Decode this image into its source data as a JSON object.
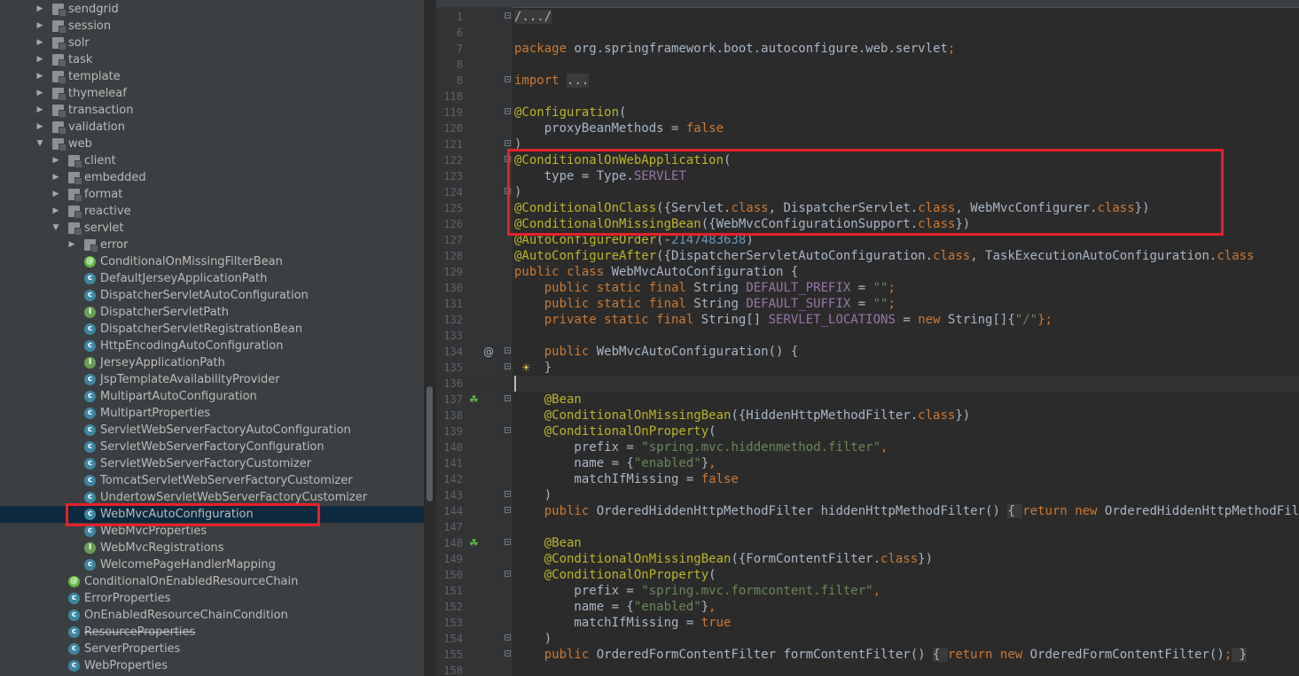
{
  "project_tree": {
    "selected_item": "WebMvcAutoConfiguration",
    "rows": [
      {
        "label": "sendgrid",
        "kind": "package",
        "depth": 0,
        "expanded": false
      },
      {
        "label": "session",
        "kind": "package",
        "depth": 0,
        "expanded": false
      },
      {
        "label": "solr",
        "kind": "package",
        "depth": 0,
        "expanded": false
      },
      {
        "label": "task",
        "kind": "package",
        "depth": 0,
        "expanded": false
      },
      {
        "label": "template",
        "kind": "package",
        "depth": 0,
        "expanded": false
      },
      {
        "label": "thymeleaf",
        "kind": "package",
        "depth": 0,
        "expanded": false
      },
      {
        "label": "transaction",
        "kind": "package",
        "depth": 0,
        "expanded": false
      },
      {
        "label": "validation",
        "kind": "package",
        "depth": 0,
        "expanded": false
      },
      {
        "label": "web",
        "kind": "package",
        "depth": 0,
        "expanded": true
      },
      {
        "label": "client",
        "kind": "package",
        "depth": 1,
        "expanded": false
      },
      {
        "label": "embedded",
        "kind": "package",
        "depth": 1,
        "expanded": false
      },
      {
        "label": "format",
        "kind": "package",
        "depth": 1,
        "expanded": false
      },
      {
        "label": "reactive",
        "kind": "package",
        "depth": 1,
        "expanded": false
      },
      {
        "label": "servlet",
        "kind": "package",
        "depth": 1,
        "expanded": true
      },
      {
        "label": "error",
        "kind": "package",
        "depth": 2,
        "expanded": false
      },
      {
        "label": "ConditionalOnMissingFilterBean",
        "kind": "annotation",
        "depth": 3
      },
      {
        "label": "DefaultJerseyApplicationPath",
        "kind": "class",
        "depth": 3
      },
      {
        "label": "DispatcherServletAutoConfiguration",
        "kind": "class",
        "depth": 3
      },
      {
        "label": "DispatcherServletPath",
        "kind": "interface",
        "depth": 3
      },
      {
        "label": "DispatcherServletRegistrationBean",
        "kind": "class",
        "depth": 3
      },
      {
        "label": "HttpEncodingAutoConfiguration",
        "kind": "class",
        "depth": 3
      },
      {
        "label": "JerseyApplicationPath",
        "kind": "interface",
        "depth": 3
      },
      {
        "label": "JspTemplateAvailabilityProvider",
        "kind": "class",
        "depth": 3
      },
      {
        "label": "MultipartAutoConfiguration",
        "kind": "class",
        "depth": 3
      },
      {
        "label": "MultipartProperties",
        "kind": "class",
        "depth": 3
      },
      {
        "label": "ServletWebServerFactoryAutoConfiguration",
        "kind": "class",
        "depth": 3
      },
      {
        "label": "ServletWebServerFactoryConfiguration",
        "kind": "class",
        "depth": 3
      },
      {
        "label": "ServletWebServerFactoryCustomizer",
        "kind": "class",
        "depth": 3
      },
      {
        "label": "TomcatServletWebServerFactoryCustomizer",
        "kind": "class",
        "depth": 3
      },
      {
        "label": "UndertowServletWebServerFactoryCustomizer",
        "kind": "class",
        "depth": 3
      },
      {
        "label": "WebMvcAutoConfiguration",
        "kind": "class",
        "depth": 3,
        "selected": true
      },
      {
        "label": "WebMvcProperties",
        "kind": "class",
        "depth": 3
      },
      {
        "label": "WebMvcRegistrations",
        "kind": "interface",
        "depth": 3
      },
      {
        "label": "WelcomePageHandlerMapping",
        "kind": "class",
        "depth": 3
      },
      {
        "label": "ConditionalOnEnabledResourceChain",
        "kind": "annotation",
        "depth": 2
      },
      {
        "label": "ErrorProperties",
        "kind": "class",
        "depth": 2
      },
      {
        "label": "OnEnabledResourceChainCondition",
        "kind": "class",
        "depth": 2
      },
      {
        "label": "ResourceProperties",
        "kind": "class",
        "depth": 2,
        "deprecated": true
      },
      {
        "label": "ServerProperties",
        "kind": "class",
        "depth": 2
      },
      {
        "label": "WebProperties",
        "kind": "class",
        "depth": 2
      }
    ]
  },
  "editor": {
    "file": "WebMvcAutoConfiguration",
    "lines": [
      {
        "no": "1",
        "fold": true,
        "spans": [
          {
            "t": "/.../",
            "c": "fb"
          }
        ]
      },
      {
        "no": "6",
        "spans": []
      },
      {
        "no": "7",
        "spans": [
          {
            "t": "package ",
            "c": "k"
          },
          {
            "t": "org.springframework.boot.autoconfigure.web.servlet"
          },
          {
            "t": ";",
            "c": "k"
          }
        ]
      },
      {
        "no": "8",
        "spans": []
      },
      {
        "no": "8",
        "fold": true,
        "spans": [
          {
            "t": "import ",
            "c": "k"
          },
          {
            "t": "...",
            "c": "fb"
          }
        ]
      },
      {
        "no": "118",
        "spans": []
      },
      {
        "no": "119",
        "fold": true,
        "spans": [
          {
            "t": "@Configuration",
            "c": "a"
          },
          {
            "t": "("
          }
        ]
      },
      {
        "no": "120",
        "spans": [
          {
            "t": "    proxyBeanMethods = "
          },
          {
            "t": "false",
            "c": "k"
          }
        ]
      },
      {
        "no": "121",
        "fold": true,
        "spans": [
          {
            "t": ")"
          }
        ]
      },
      {
        "no": "122",
        "fold": true,
        "spans": [
          {
            "t": "@ConditionalOnWebApplication",
            "c": "a"
          },
          {
            "t": "("
          }
        ]
      },
      {
        "no": "123",
        "spans": [
          {
            "t": "    type = Type."
          },
          {
            "t": "SERVLET",
            "c": "fld"
          }
        ]
      },
      {
        "no": "124",
        "fold": true,
        "spans": [
          {
            "t": ")"
          }
        ]
      },
      {
        "no": "125",
        "spans": [
          {
            "t": "@ConditionalOnClass",
            "c": "a"
          },
          {
            "t": "({Servlet."
          },
          {
            "t": "class",
            "c": "k"
          },
          {
            "t": ", DispatcherServlet."
          },
          {
            "t": "class",
            "c": "k"
          },
          {
            "t": ", WebMvcConfigurer."
          },
          {
            "t": "class",
            "c": "k"
          },
          {
            "t": "})"
          }
        ]
      },
      {
        "no": "126",
        "spans": [
          {
            "t": "@ConditionalOnMissingBean",
            "c": "a"
          },
          {
            "t": "({WebMvcConfigurationSupport."
          },
          {
            "t": "class",
            "c": "k"
          },
          {
            "t": "})"
          }
        ]
      },
      {
        "no": "127",
        "spans": [
          {
            "t": "@AutoConfigureOrder",
            "c": "a"
          },
          {
            "t": "(-"
          },
          {
            "t": "2147483638",
            "c": "n"
          },
          {
            "t": ")"
          }
        ]
      },
      {
        "no": "128",
        "spans": [
          {
            "t": "@AutoConfigureAfter",
            "c": "a"
          },
          {
            "t": "({DispatcherServletAutoConfiguration."
          },
          {
            "t": "class",
            "c": "k"
          },
          {
            "t": ", TaskExecutionAutoConfiguration."
          },
          {
            "t": "class",
            "c": "k"
          }
        ]
      },
      {
        "no": "129",
        "spans": [
          {
            "t": "public class ",
            "c": "k"
          },
          {
            "t": "WebMvcAutoConfiguration {"
          }
        ]
      },
      {
        "no": "130",
        "spans": [
          {
            "t": "    "
          },
          {
            "t": "public static final ",
            "c": "k"
          },
          {
            "t": "String "
          },
          {
            "t": "DEFAULT_PREFIX",
            "c": "fld"
          },
          {
            "t": " = "
          },
          {
            "t": "\"\"",
            "c": "s"
          },
          {
            "t": ";",
            "c": "k"
          }
        ]
      },
      {
        "no": "131",
        "spans": [
          {
            "t": "    "
          },
          {
            "t": "public static final ",
            "c": "k"
          },
          {
            "t": "String "
          },
          {
            "t": "DEFAULT_SUFFIX",
            "c": "fld"
          },
          {
            "t": " = "
          },
          {
            "t": "\"\"",
            "c": "s"
          },
          {
            "t": ";",
            "c": "k"
          }
        ]
      },
      {
        "no": "132",
        "spans": [
          {
            "t": "    "
          },
          {
            "t": "private static final ",
            "c": "k"
          },
          {
            "t": "String[] "
          },
          {
            "t": "SERVLET_LOCATIONS",
            "c": "fld"
          },
          {
            "t": " = "
          },
          {
            "t": "new ",
            "c": "k"
          },
          {
            "t": "String[]{"
          },
          {
            "t": "\"/\"",
            "c": "s"
          },
          {
            "t": "};",
            "c": "k"
          }
        ]
      },
      {
        "no": "133",
        "spans": []
      },
      {
        "no": "134",
        "fold": true,
        "icon": "override",
        "spans": [
          {
            "t": "    "
          },
          {
            "t": "public ",
            "c": "k"
          },
          {
            "t": "WebMvcAutoConfiguration() {"
          }
        ]
      },
      {
        "no": "135",
        "fold": true,
        "icon": "bulb",
        "spans": [
          {
            "t": "    }"
          }
        ]
      },
      {
        "no": "136",
        "caret": true,
        "spans": []
      },
      {
        "no": "137",
        "fold": true,
        "icon": "bean",
        "spans": [
          {
            "t": "    "
          },
          {
            "t": "@Bean",
            "c": "a"
          }
        ]
      },
      {
        "no": "138",
        "spans": [
          {
            "t": "    "
          },
          {
            "t": "@ConditionalOnMissingBean",
            "c": "a"
          },
          {
            "t": "({HiddenHttpMethodFilter."
          },
          {
            "t": "class",
            "c": "k"
          },
          {
            "t": "})"
          }
        ]
      },
      {
        "no": "139",
        "fold": true,
        "spans": [
          {
            "t": "    "
          },
          {
            "t": "@ConditionalOnProperty",
            "c": "a"
          },
          {
            "t": "("
          }
        ]
      },
      {
        "no": "140",
        "spans": [
          {
            "t": "        prefix = "
          },
          {
            "t": "\"spring.mvc.hiddenmethod.filter\"",
            "c": "s"
          },
          {
            "t": ",",
            "c": "k"
          }
        ]
      },
      {
        "no": "141",
        "spans": [
          {
            "t": "        name = {"
          },
          {
            "t": "\"enabled\"",
            "c": "s"
          },
          {
            "t": "}"
          },
          {
            "t": ",",
            "c": "k"
          }
        ]
      },
      {
        "no": "142",
        "spans": [
          {
            "t": "        matchIfMissing = "
          },
          {
            "t": "false",
            "c": "k"
          }
        ]
      },
      {
        "no": "143",
        "fold": true,
        "spans": [
          {
            "t": "    )"
          }
        ]
      },
      {
        "no": "144",
        "fold": true,
        "spans": [
          {
            "t": "    "
          },
          {
            "t": "public ",
            "c": "k"
          },
          {
            "t": "OrderedHiddenHttpMethodFilter hiddenHttpMethodFilter() "
          },
          {
            "t": "{ ",
            "c": "fb"
          },
          {
            "t": "return new ",
            "c": "k"
          },
          {
            "t": "OrderedHiddenHttpMethodFilter()"
          }
        ]
      },
      {
        "no": "147",
        "spans": []
      },
      {
        "no": "148",
        "fold": true,
        "icon": "bean",
        "spans": [
          {
            "t": "    "
          },
          {
            "t": "@Bean",
            "c": "a"
          }
        ]
      },
      {
        "no": "149",
        "spans": [
          {
            "t": "    "
          },
          {
            "t": "@ConditionalOnMissingBean",
            "c": "a"
          },
          {
            "t": "({FormContentFilter."
          },
          {
            "t": "class",
            "c": "k"
          },
          {
            "t": "})"
          }
        ]
      },
      {
        "no": "150",
        "fold": true,
        "spans": [
          {
            "t": "    "
          },
          {
            "t": "@ConditionalOnProperty",
            "c": "a"
          },
          {
            "t": "("
          }
        ]
      },
      {
        "no": "151",
        "spans": [
          {
            "t": "        prefix = "
          },
          {
            "t": "\"spring.mvc.formcontent.filter\"",
            "c": "s"
          },
          {
            "t": ",",
            "c": "k"
          }
        ]
      },
      {
        "no": "152",
        "spans": [
          {
            "t": "        name = {"
          },
          {
            "t": "\"enabled\"",
            "c": "s"
          },
          {
            "t": "}"
          },
          {
            "t": ",",
            "c": "k"
          }
        ]
      },
      {
        "no": "153",
        "spans": [
          {
            "t": "        matchIfMissing = "
          },
          {
            "t": "true",
            "c": "k"
          }
        ]
      },
      {
        "no": "154",
        "fold": true,
        "spans": [
          {
            "t": "    )"
          }
        ]
      },
      {
        "no": "155",
        "fold": true,
        "spans": [
          {
            "t": "    "
          },
          {
            "t": "public ",
            "c": "k"
          },
          {
            "t": "OrderedFormContentFilter formContentFilter() "
          },
          {
            "t": "{ ",
            "c": "fb"
          },
          {
            "t": "return new ",
            "c": "k"
          },
          {
            "t": "OrderedFormContentFilter()"
          },
          {
            "t": ";",
            "c": "k"
          },
          {
            "t": " }",
            "c": "fb"
          }
        ]
      },
      {
        "no": "158",
        "spans": []
      }
    ]
  },
  "icons": {
    "package": "package-icon",
    "class": "class-icon",
    "annotation": "annotation-icon",
    "interface": "interface-icon",
    "override": "at-sign-icon",
    "bean": "bean-icon",
    "bulb": "lightbulb-icon"
  },
  "highlight_color": "#e8202a"
}
